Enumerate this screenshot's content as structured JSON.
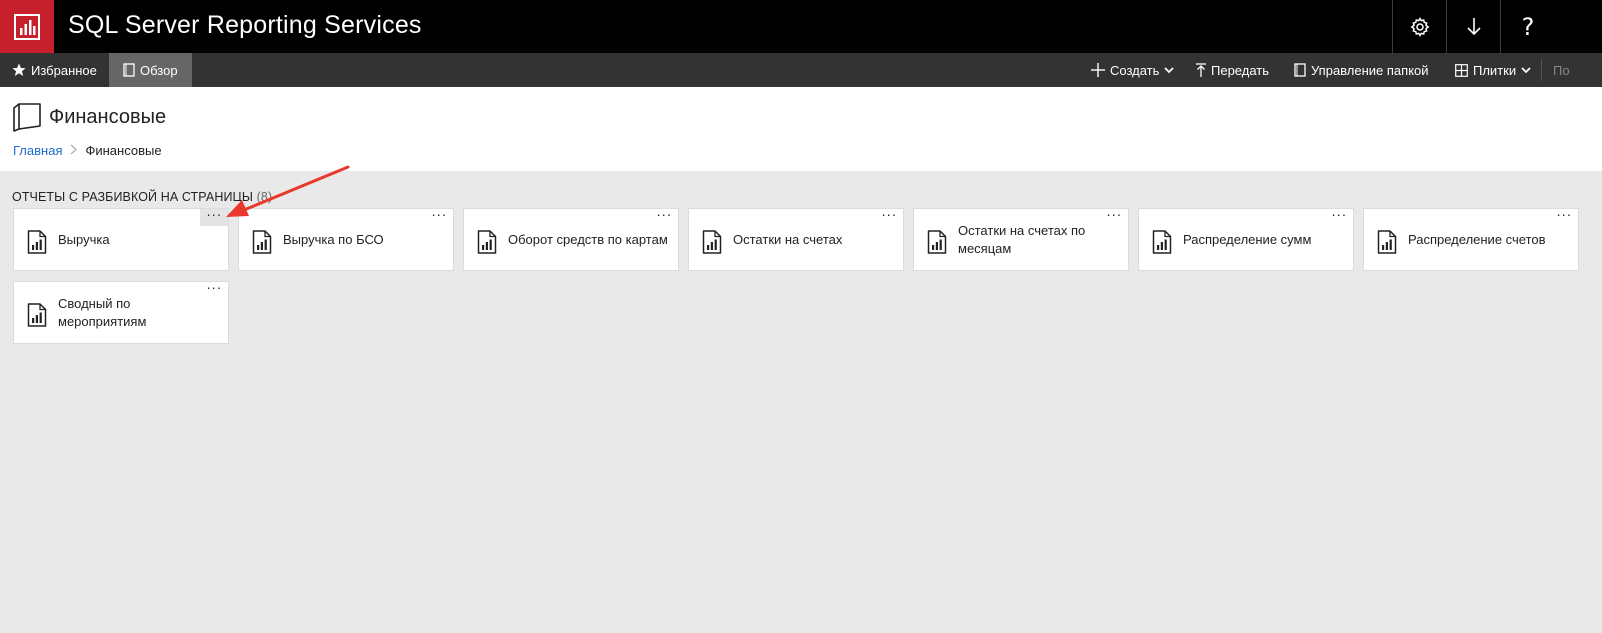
{
  "app": {
    "title": "SQL Server Reporting Services"
  },
  "topbar_icons": [
    "gear-icon",
    "download-icon",
    "help-icon"
  ],
  "help_glyph": "?",
  "nav": {
    "favorites": "Избранное",
    "browse": "Обзор",
    "new": "Создать",
    "upload": "Передать",
    "manage_folder": "Управление папкой",
    "tiles": "Плитки",
    "search_placeholder": "По"
  },
  "page": {
    "title": "Финансовые",
    "breadcrumb": {
      "home": "Главная",
      "current": "Финансовые"
    }
  },
  "section": {
    "title": "ОТЧЕТЫ С РАЗБИВКОЙ НА СТРАНИЦЫ",
    "count": "(8)"
  },
  "tiles": [
    {
      "label": "Выручка",
      "menu": "···"
    },
    {
      "label": "Выручка по БСО",
      "menu": "···"
    },
    {
      "label": "Оборот средств по картам",
      "menu": "···"
    },
    {
      "label": "Остатки на счетах",
      "menu": "···"
    },
    {
      "label": "Остатки на счетах по месяцам",
      "menu": "···"
    },
    {
      "label": "Распределение сумм",
      "menu": "···"
    },
    {
      "label": "Распределение счетов",
      "menu": "···"
    },
    {
      "label": "Сводный по мероприятиям",
      "menu": "···"
    }
  ],
  "colors": {
    "brand_red": "#c5202c",
    "topbar": "#000000",
    "navbar": "#333333",
    "link": "#1e6bd6",
    "annotation_arrow": "#e8392c"
  }
}
